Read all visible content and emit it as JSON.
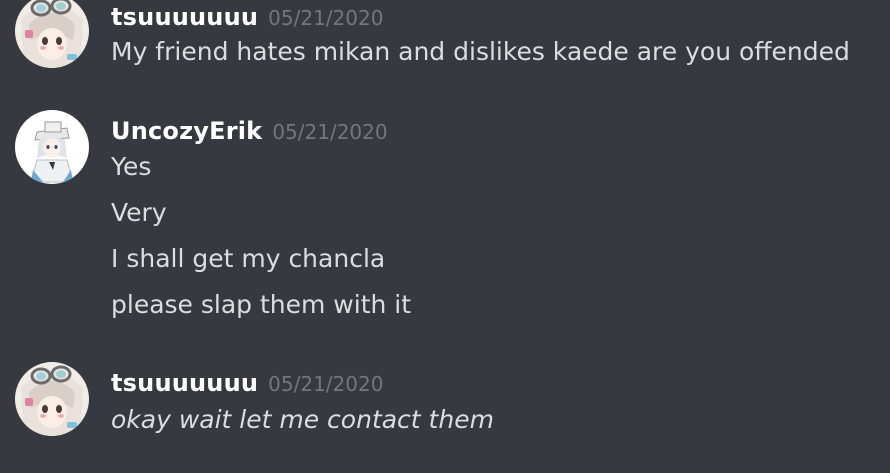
{
  "messages": [
    {
      "author": "tsuuuuuuu",
      "timestamp": "05/21/2020",
      "avatar_icon": "anime-girl-goggles-avatar",
      "lines": [
        "My friend hates mikan and dislikes kaede are you offended"
      ]
    },
    {
      "author": "UncozyErik",
      "timestamp": "05/21/2020",
      "avatar_icon": "anime-character-white-hat-avatar",
      "lines": [
        "Yes",
        "Very",
        "I shall get my chancla",
        "please slap them with it"
      ]
    },
    {
      "author": "tsuuuuuuu",
      "timestamp": "05/21/2020",
      "avatar_icon": "anime-girl-goggles-avatar",
      "lines": [
        "okay wait let me contact them"
      ],
      "italic": true
    }
  ],
  "colors": {
    "background": "#36393f",
    "username": "#ffffff",
    "timestamp": "#72767d",
    "message_text": "#dcddde"
  }
}
